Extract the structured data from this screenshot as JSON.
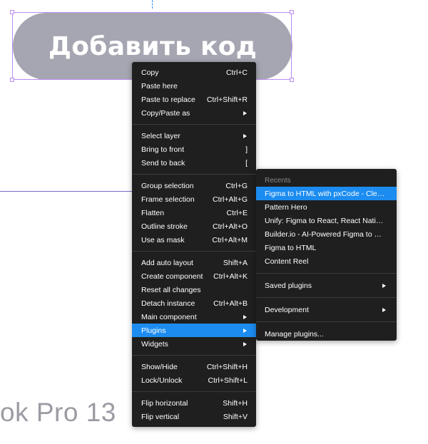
{
  "canvas": {
    "button_text": "Добавить код",
    "bg_text": "ok Pro 13"
  },
  "colors": {
    "menu_bg": "#1f1f1f",
    "highlight": "#1c8cf0",
    "selection": "#b98cf2",
    "button_bg": "#a5a6b1"
  },
  "context_menu": {
    "groups": [
      [
        {
          "label": "Copy",
          "shortcut": "Ctrl+C"
        },
        {
          "label": "Paste here",
          "shortcut": ""
        },
        {
          "label": "Paste to replace",
          "shortcut": "Ctrl+Shift+R"
        },
        {
          "label": "Copy/Paste as",
          "shortcut": "",
          "submenu": true
        }
      ],
      [
        {
          "label": "Select layer",
          "shortcut": "",
          "submenu": true
        },
        {
          "label": "Bring to front",
          "shortcut": "]"
        },
        {
          "label": "Send to back",
          "shortcut": "["
        }
      ],
      [
        {
          "label": "Group selection",
          "shortcut": "Ctrl+G"
        },
        {
          "label": "Frame selection",
          "shortcut": "Ctrl+Alt+G"
        },
        {
          "label": "Flatten",
          "shortcut": "Ctrl+E"
        },
        {
          "label": "Outline stroke",
          "shortcut": "Ctrl+Alt+O"
        },
        {
          "label": "Use as mask",
          "shortcut": "Ctrl+Alt+M"
        }
      ],
      [
        {
          "label": "Add auto layout",
          "shortcut": "Shift+A"
        },
        {
          "label": "Create component",
          "shortcut": "Ctrl+Alt+K"
        },
        {
          "label": "Reset all changes",
          "shortcut": ""
        },
        {
          "label": "Detach instance",
          "shortcut": "Ctrl+Alt+B"
        },
        {
          "label": "Main component",
          "shortcut": "",
          "submenu": true
        },
        {
          "label": "Plugins",
          "shortcut": "",
          "submenu": true,
          "active": true
        },
        {
          "label": "Widgets",
          "shortcut": "",
          "submenu": true
        }
      ],
      [
        {
          "label": "Show/Hide",
          "shortcut": "Ctrl+Shift+H"
        },
        {
          "label": "Lock/Unlock",
          "shortcut": "Ctrl+Shift+L"
        }
      ],
      [
        {
          "label": "Flip horizontal",
          "shortcut": "Shift+H"
        },
        {
          "label": "Flip vertical",
          "shortcut": "Shift+V"
        }
      ]
    ]
  },
  "plugins_menu": {
    "recents_header": "Recents",
    "recents": [
      "Figma to HTML with pxCode - Clean ...",
      "Pattern Hero",
      "Unify: Figma to React, React Native ...",
      "Builder.io - AI-Powered Figma to Cod...",
      "Figma to HTML",
      "Content Reel"
    ],
    "saved_plugins": "Saved plugins",
    "development": "Development",
    "manage_plugins": "Manage plugins..."
  }
}
